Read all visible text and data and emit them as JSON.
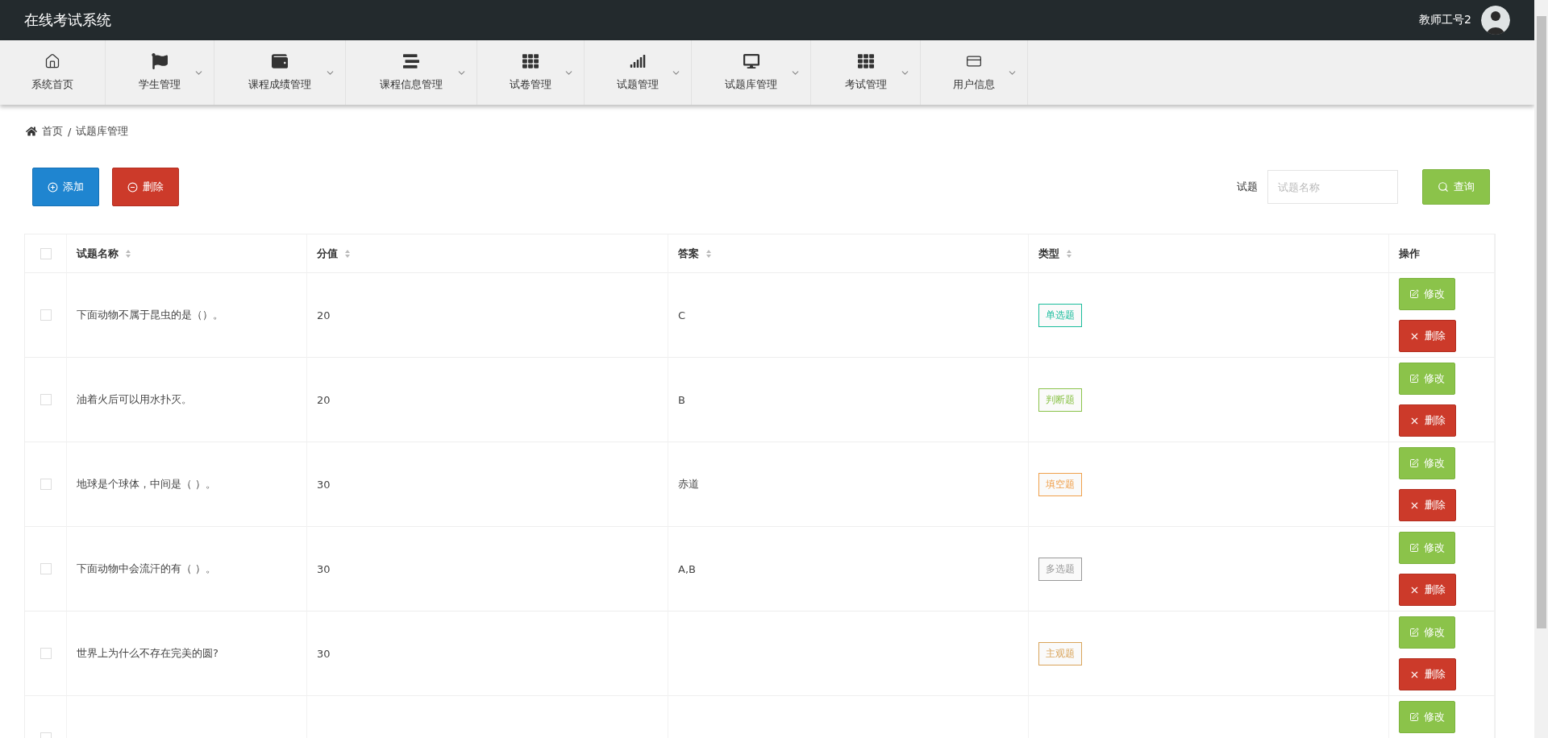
{
  "header": {
    "title": "在线考试系统",
    "user": "教师工号2"
  },
  "nav": [
    {
      "label": "系统首页",
      "has_menu": false,
      "selected": false
    },
    {
      "label": "学生管理",
      "has_menu": true,
      "selected": false
    },
    {
      "label": "课程成绩管理",
      "has_menu": true,
      "selected": false
    },
    {
      "label": "课程信息管理",
      "has_menu": true,
      "selected": false
    },
    {
      "label": "试卷管理",
      "has_menu": true,
      "selected": false
    },
    {
      "label": "试题管理",
      "has_menu": true,
      "selected": false
    },
    {
      "label": "试题库管理",
      "has_menu": true,
      "selected": false
    },
    {
      "label": "考试管理",
      "has_menu": true,
      "selected": false
    },
    {
      "label": "用户信息",
      "has_menu": true,
      "selected": false
    }
  ],
  "breadcrumb": {
    "home": "首页",
    "separator": "/",
    "current": "试题库管理"
  },
  "toolbar": {
    "add": "添加",
    "delete": "删除",
    "search_label": "试题",
    "search_placeholder": "试题名称",
    "search_button": "查询"
  },
  "table": {
    "select_all_checked": false,
    "columns": [
      {
        "label": "试题名称",
        "sortable": true
      },
      {
        "label": "分值",
        "sortable": true
      },
      {
        "label": "答案",
        "sortable": true
      },
      {
        "label": "类型",
        "sortable": true
      },
      {
        "label": "操作",
        "sortable": false
      }
    ],
    "rows": [
      {
        "checked": false,
        "name": "下面动物不属于昆虫的是（）。",
        "score": "20",
        "answer": "C",
        "type": "单选题",
        "color": "#1abc9c",
        "actions": [
          "修改",
          "删除"
        ]
      },
      {
        "checked": false,
        "name": "油着火后可以用水扑灭。",
        "score": "20",
        "answer": "B",
        "type": "判断题",
        "color": "#8bc34a",
        "actions": [
          "修改",
          "删除"
        ]
      },
      {
        "checked": false,
        "name": "地球是个球体，中间是（ ）。",
        "score": "30",
        "answer": "赤道",
        "type": "填空题",
        "color": "#f0a04b",
        "actions": [
          "修改",
          "删除"
        ]
      },
      {
        "checked": false,
        "name": "下面动物中会流汗的有（ ）。",
        "score": "30",
        "answer": "A,B",
        "type": "多选题",
        "color": "#999999",
        "actions": [
          "修改",
          "删除"
        ]
      },
      {
        "checked": false,
        "name": "世界上为什么不存在完美的圆?",
        "score": "30",
        "type": "主观题",
        "color": "#d9a45a",
        "actions": [
          "修改",
          "删除"
        ]
      },
      {
        "checked": false,
        "actions": [
          "修改"
        ]
      }
    ]
  }
}
